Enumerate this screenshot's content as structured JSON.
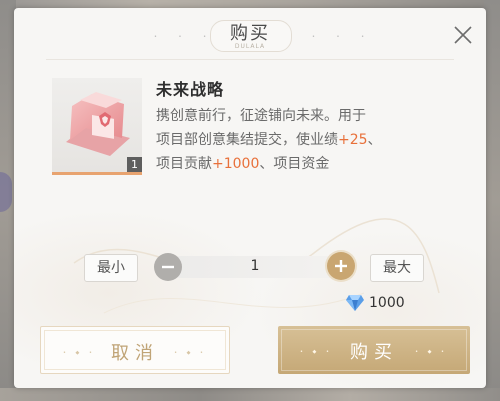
{
  "dialog": {
    "title": "购买",
    "subtitle": "DULALA"
  },
  "item": {
    "name": "未来战略",
    "quantity_badge": "1",
    "desc_line1": "携创意前行，征途铺向未来。用于",
    "desc_line2_pre": "项目部创意集结提交，使业绩",
    "desc_line2_hl": "+25",
    "desc_line2_post": "、",
    "desc_line3_pre": "项目贡献",
    "desc_line3_hl": "+1000",
    "desc_line3_post": "、项目资金"
  },
  "quantity": {
    "min_label": "最小",
    "max_label": "最大",
    "value": "1"
  },
  "cost": {
    "amount": "1000",
    "currency_icon": "diamond-icon"
  },
  "buttons": {
    "cancel": "取消",
    "buy": "购买"
  },
  "colors": {
    "highlight": "#e8703a",
    "gold": "#c9a671",
    "accent_bar": "#e8a36f"
  }
}
